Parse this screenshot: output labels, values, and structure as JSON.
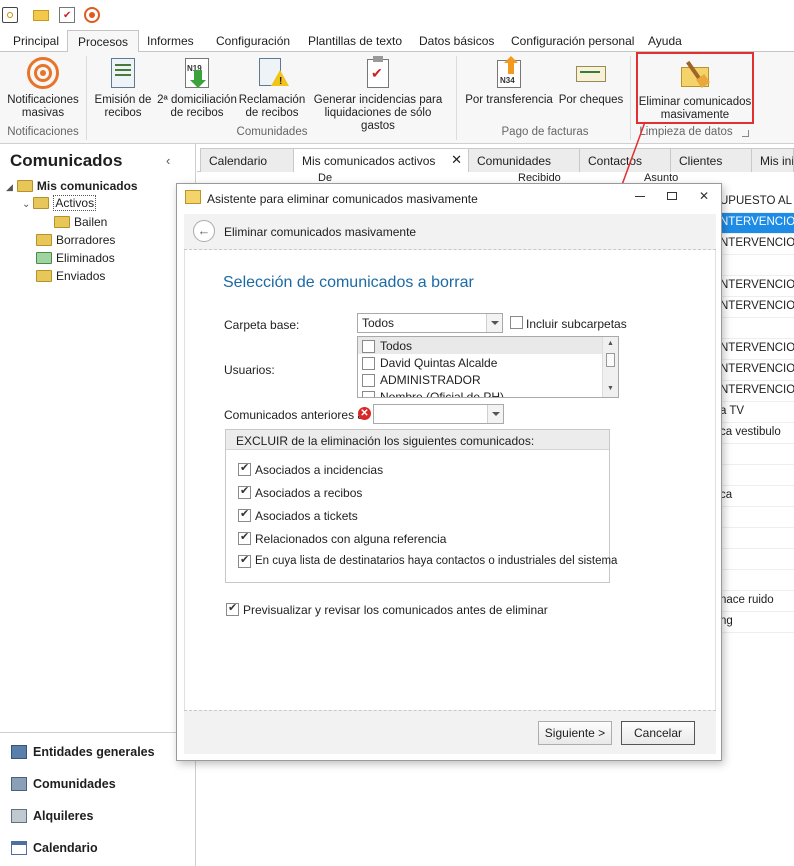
{
  "qat": {
    "icons": [
      "app-icon",
      "mail-icon",
      "tasks-icon",
      "broadcast-icon"
    ]
  },
  "tabs": [
    "Principal",
    "Procesos",
    "Informes",
    "Configuración",
    "Plantillas de texto",
    "Datos básicos",
    "Configuración personal",
    "Ayuda"
  ],
  "ribbon": {
    "buttons": [
      {
        "label1": "Notificaciones",
        "label2": "masivas"
      },
      {
        "label1": "Emisión de",
        "label2": "recibos"
      },
      {
        "label1": "2ª domiciliación",
        "label2": "de recibos"
      },
      {
        "label1": "Reclamación",
        "label2": "de recibos"
      },
      {
        "label1": "Generar incidencias para",
        "label2": "liquidaciones de sólo gastos"
      },
      {
        "label1": "Por transferencia",
        "label2": ""
      },
      {
        "label1": "Por cheques",
        "label2": ""
      },
      {
        "label1": "Eliminar comunicados",
        "label2": "masivamente"
      }
    ],
    "groups": [
      "Notificaciones",
      "Comunidades",
      "Pago de facturas",
      "Limpieza de datos"
    ],
    "icon_codes": {
      "n19": "N19",
      "n34": "N34"
    }
  },
  "left": {
    "title": "Comunicados",
    "tree": {
      "root": "Mis comunicados",
      "activos": "Activos",
      "bailen": "Bailen",
      "borradores": "Borradores",
      "eliminados": "Eliminados",
      "enviados": "Enviados"
    },
    "nav": [
      "Entidades generales",
      "Comunidades",
      "Alquileres",
      "Calendario"
    ]
  },
  "doctabs": [
    "Calendario",
    "Mis comunicados activos",
    "Comunidades",
    "Contactos",
    "Clientes",
    "Mis inici"
  ],
  "grid": {
    "headers": [
      "De",
      "Recibido",
      "Asunto"
    ],
    "rows": [
      "UPUESTO AL PR",
      "NTERVENCION",
      "NTERVENCION",
      "",
      "NTERVENCION",
      "NTERVENCION",
      "",
      "NTERVENCION",
      "NTERVENCION",
      "NTERVENCION",
      "a TV",
      "ca vestibulo",
      "",
      "",
      "ca",
      "",
      "",
      "",
      "",
      "nace ruido",
      "ng"
    ]
  },
  "dialog": {
    "title": "Asistente para eliminar comunicados masivamente",
    "header": "Eliminar comunicados masivamente",
    "section_title": "Selección de comunicados a borrar",
    "carpeta_label": "Carpeta base:",
    "carpeta_value": "Todos",
    "incluir_sub": "Incluir subcarpetas",
    "usuarios_label": "Usuarios:",
    "usuarios": [
      "Todos",
      "David Quintas Alcalde",
      "ADMINISTRADOR",
      "Nombre (Oficial de PH)"
    ],
    "anteriores_label": "Comunicados anteriores a:",
    "anteriores_value": "",
    "excluir_title": "EXCLUIR de la eliminación los siguientes comunicados:",
    "excluir": [
      "Asociados a incidencias",
      "Asociados a recibos",
      "Asociados a tickets",
      "Relacionados con alguna referencia",
      "En cuya lista de destinatarios haya contactos o industriales del sistema"
    ],
    "previsualizar": "Previsualizar y revisar los comunicados antes de eliminar",
    "siguiente": "Siguiente >",
    "cancelar": "Cancelar"
  },
  "colors": {
    "accent": "#1e73be",
    "selection": "#1e8ce6",
    "highlight": "#e03030",
    "title_blue": "#1b6aa5"
  }
}
